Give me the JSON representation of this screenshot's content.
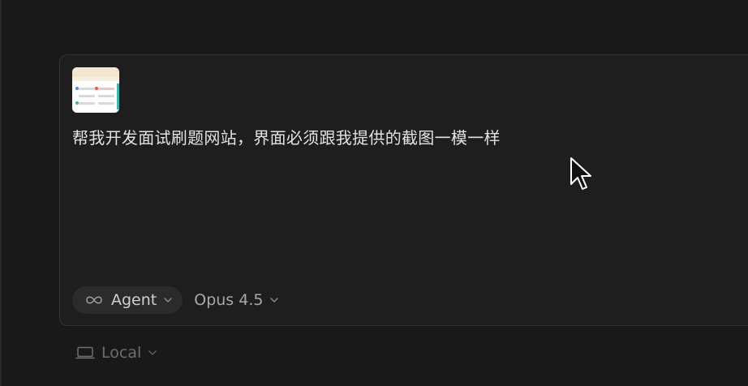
{
  "composer": {
    "prompt_text": "帮我开发面试刷题网站，界面必须跟我提供的截图一模一样",
    "attachment_icon": "image-thumbnail"
  },
  "footer": {
    "mode_label": "Agent",
    "mode_icon": "infinity-icon",
    "model_label": "Opus 4.5"
  },
  "environment": {
    "label": "Local",
    "icon": "laptop-icon"
  },
  "colors": {
    "background": "#191919",
    "composer_bg": "#1e1e1e",
    "pill_bg": "#2b2b2b",
    "text_primary": "#e2e2e2",
    "text_muted": "#a8a8a8",
    "text_dim": "#6e6e6e"
  }
}
